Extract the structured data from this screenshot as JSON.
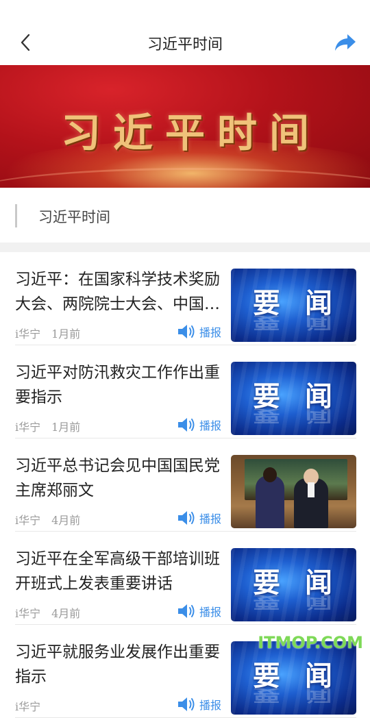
{
  "header": {
    "title": "习近平时间"
  },
  "banner": {
    "text": "习近平时间"
  },
  "section": {
    "title": "习近平时间"
  },
  "news": [
    {
      "title": "习近平：在国家科学技术奖励大会、两院院士大会、中国科协第十一次全国代表大会上的讲话",
      "source": "i华宁",
      "time": "1月前",
      "play": "播报",
      "thumb": "yaowen"
    },
    {
      "title": "习近平对防汛救灾工作作出重要指示",
      "source": "i华宁",
      "time": "1月前",
      "play": "播报",
      "thumb": "yaowen"
    },
    {
      "title": "习近平总书记会见中国国民党主席郑丽文",
      "source": "i华宁",
      "time": "4月前",
      "play": "播报",
      "thumb": "photo"
    },
    {
      "title": "习近平在全军高级干部培训班开班式上发表重要讲话",
      "source": "i华宁",
      "time": "4月前",
      "play": "播报",
      "thumb": "yaowen"
    },
    {
      "title": "习近平就服务业发展作出重要指示",
      "source": "i华宁",
      "time": "",
      "play": "播报",
      "thumb": "yaowen"
    }
  ],
  "thumb_text": {
    "w1": "要",
    "w2": "闻"
  },
  "watermark": "ITMOP.COM",
  "colors": {
    "accent": "#3b8ee8",
    "banner_red": "#b3121a",
    "banner_gold": "#f0c27a"
  },
  "icons": {
    "back": "chevron-left-icon",
    "share": "share-arrow-icon",
    "play": "speaker-icon"
  }
}
